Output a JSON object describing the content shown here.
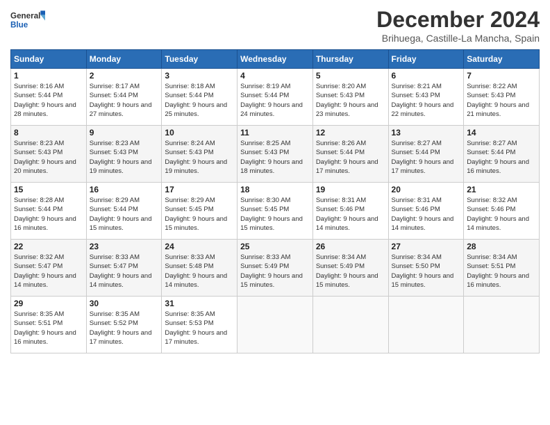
{
  "header": {
    "logo_general": "General",
    "logo_blue": "Blue",
    "month_title": "December 2024",
    "location": "Brihuega, Castille-La Mancha, Spain"
  },
  "calendar": {
    "days_of_week": [
      "Sunday",
      "Monday",
      "Tuesday",
      "Wednesday",
      "Thursday",
      "Friday",
      "Saturday"
    ],
    "weeks": [
      [
        {
          "day": "1",
          "sunrise": "8:16 AM",
          "sunset": "5:44 PM",
          "daylight": "9 hours and 28 minutes."
        },
        {
          "day": "2",
          "sunrise": "8:17 AM",
          "sunset": "5:44 PM",
          "daylight": "9 hours and 27 minutes."
        },
        {
          "day": "3",
          "sunrise": "8:18 AM",
          "sunset": "5:44 PM",
          "daylight": "9 hours and 25 minutes."
        },
        {
          "day": "4",
          "sunrise": "8:19 AM",
          "sunset": "5:44 PM",
          "daylight": "9 hours and 24 minutes."
        },
        {
          "day": "5",
          "sunrise": "8:20 AM",
          "sunset": "5:43 PM",
          "daylight": "9 hours and 23 minutes."
        },
        {
          "day": "6",
          "sunrise": "8:21 AM",
          "sunset": "5:43 PM",
          "daylight": "9 hours and 22 minutes."
        },
        {
          "day": "7",
          "sunrise": "8:22 AM",
          "sunset": "5:43 PM",
          "daylight": "9 hours and 21 minutes."
        }
      ],
      [
        {
          "day": "8",
          "sunrise": "8:23 AM",
          "sunset": "5:43 PM",
          "daylight": "9 hours and 20 minutes."
        },
        {
          "day": "9",
          "sunrise": "8:23 AM",
          "sunset": "5:43 PM",
          "daylight": "9 hours and 19 minutes."
        },
        {
          "day": "10",
          "sunrise": "8:24 AM",
          "sunset": "5:43 PM",
          "daylight": "9 hours and 19 minutes."
        },
        {
          "day": "11",
          "sunrise": "8:25 AM",
          "sunset": "5:43 PM",
          "daylight": "9 hours and 18 minutes."
        },
        {
          "day": "12",
          "sunrise": "8:26 AM",
          "sunset": "5:44 PM",
          "daylight": "9 hours and 17 minutes."
        },
        {
          "day": "13",
          "sunrise": "8:27 AM",
          "sunset": "5:44 PM",
          "daylight": "9 hours and 17 minutes."
        },
        {
          "day": "14",
          "sunrise": "8:27 AM",
          "sunset": "5:44 PM",
          "daylight": "9 hours and 16 minutes."
        }
      ],
      [
        {
          "day": "15",
          "sunrise": "8:28 AM",
          "sunset": "5:44 PM",
          "daylight": "9 hours and 16 minutes."
        },
        {
          "day": "16",
          "sunrise": "8:29 AM",
          "sunset": "5:44 PM",
          "daylight": "9 hours and 15 minutes."
        },
        {
          "day": "17",
          "sunrise": "8:29 AM",
          "sunset": "5:45 PM",
          "daylight": "9 hours and 15 minutes."
        },
        {
          "day": "18",
          "sunrise": "8:30 AM",
          "sunset": "5:45 PM",
          "daylight": "9 hours and 15 minutes."
        },
        {
          "day": "19",
          "sunrise": "8:31 AM",
          "sunset": "5:46 PM",
          "daylight": "9 hours and 14 minutes."
        },
        {
          "day": "20",
          "sunrise": "8:31 AM",
          "sunset": "5:46 PM",
          "daylight": "9 hours and 14 minutes."
        },
        {
          "day": "21",
          "sunrise": "8:32 AM",
          "sunset": "5:46 PM",
          "daylight": "9 hours and 14 minutes."
        }
      ],
      [
        {
          "day": "22",
          "sunrise": "8:32 AM",
          "sunset": "5:47 PM",
          "daylight": "9 hours and 14 minutes."
        },
        {
          "day": "23",
          "sunrise": "8:33 AM",
          "sunset": "5:47 PM",
          "daylight": "9 hours and 14 minutes."
        },
        {
          "day": "24",
          "sunrise": "8:33 AM",
          "sunset": "5:48 PM",
          "daylight": "9 hours and 14 minutes."
        },
        {
          "day": "25",
          "sunrise": "8:33 AM",
          "sunset": "5:49 PM",
          "daylight": "9 hours and 15 minutes."
        },
        {
          "day": "26",
          "sunrise": "8:34 AM",
          "sunset": "5:49 PM",
          "daylight": "9 hours and 15 minutes."
        },
        {
          "day": "27",
          "sunrise": "8:34 AM",
          "sunset": "5:50 PM",
          "daylight": "9 hours and 15 minutes."
        },
        {
          "day": "28",
          "sunrise": "8:34 AM",
          "sunset": "5:51 PM",
          "daylight": "9 hours and 16 minutes."
        }
      ],
      [
        {
          "day": "29",
          "sunrise": "8:35 AM",
          "sunset": "5:51 PM",
          "daylight": "9 hours and 16 minutes."
        },
        {
          "day": "30",
          "sunrise": "8:35 AM",
          "sunset": "5:52 PM",
          "daylight": "9 hours and 17 minutes."
        },
        {
          "day": "31",
          "sunrise": "8:35 AM",
          "sunset": "5:53 PM",
          "daylight": "9 hours and 17 minutes."
        },
        null,
        null,
        null,
        null
      ]
    ]
  }
}
